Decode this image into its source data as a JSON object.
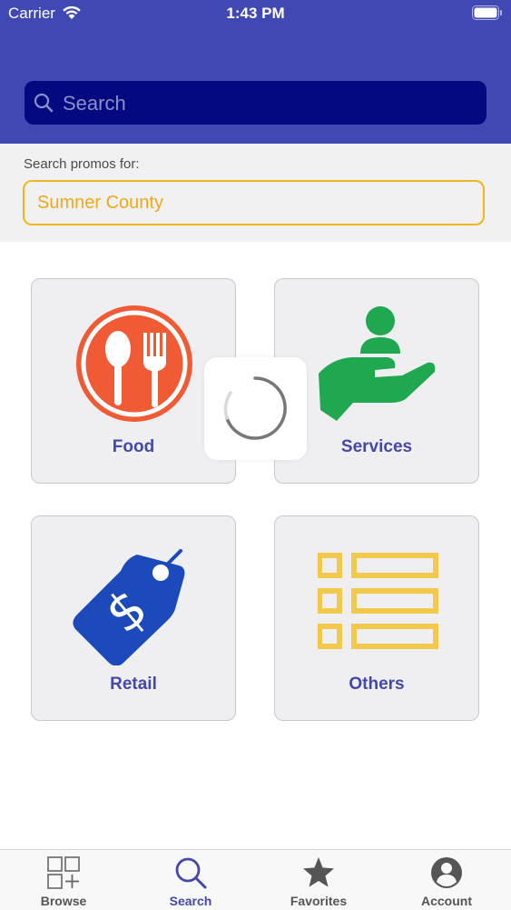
{
  "status_bar": {
    "carrier": "Carrier",
    "time": "1:43 PM"
  },
  "search": {
    "placeholder": "Search",
    "value": ""
  },
  "location": {
    "label": "Search promos for:",
    "value": "Sumner County"
  },
  "categories": [
    {
      "label": "Food",
      "icon": "food-icon",
      "color": "#f05a35"
    },
    {
      "label": "Services",
      "icon": "services-icon",
      "color": "#1fa84f"
    },
    {
      "label": "Retail",
      "icon": "retail-icon",
      "color": "#1d4aba"
    },
    {
      "label": "Others",
      "icon": "others-icon",
      "color": "#f2c94a"
    }
  ],
  "tabbar": {
    "items": [
      {
        "label": "Browse",
        "icon": "browse-icon"
      },
      {
        "label": "Search",
        "icon": "search-icon"
      },
      {
        "label": "Favorites",
        "icon": "star-icon"
      },
      {
        "label": "Account",
        "icon": "account-icon"
      }
    ],
    "active": "Search"
  },
  "colors": {
    "header": "#4048b4",
    "search_bar": "#040980",
    "accent": "#f3b41c",
    "label": "#4448a8"
  }
}
